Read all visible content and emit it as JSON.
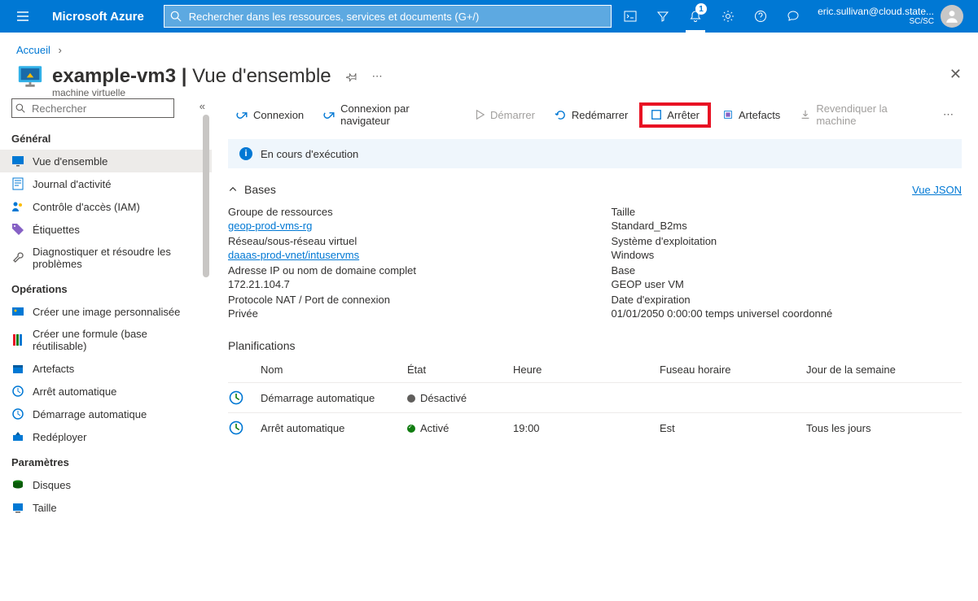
{
  "topbar": {
    "brand": "Microsoft Azure",
    "search_placeholder": "Rechercher dans les ressources, services et documents (G+/)",
    "notification_count": "1",
    "user_email": "eric.sullivan@cloud.state...",
    "user_org": "SC/SC"
  },
  "breadcrumb": {
    "home": "Accueil"
  },
  "header": {
    "title": "example-vm3",
    "view": "Vue d'ensemble",
    "subtitle": "machine virtuelle"
  },
  "sidebar": {
    "search_placeholder": "Rechercher",
    "groups": {
      "general": "Général",
      "operations": "Opérations",
      "parameters": "Paramètres"
    },
    "items": {
      "overview": "Vue d'ensemble",
      "activity": "Journal d'activité",
      "iam": "Contrôle d'accès (IAM)",
      "tags": "Étiquettes",
      "diag": "Diagnostiquer et résoudre les problèmes",
      "create_image": "Créer une image personnalisée",
      "create_formula": "Créer une formule (base réutilisable)",
      "artefacts": "Artefacts",
      "autoshutdown": "Arrêt automatique",
      "autostart": "Démarrage automatique",
      "redeploy": "Redéployer",
      "disks": "Disques",
      "size": "Taille"
    }
  },
  "toolbar": {
    "connect": "Connexion",
    "browser_connect": "Connexion par navigateur",
    "start": "Démarrer",
    "restart": "Redémarrer",
    "stop": "Arrêter",
    "artefacts": "Artefacts",
    "claim": "Revendiquer la machine"
  },
  "status": {
    "running": "En cours d'exécution"
  },
  "bases": {
    "section_title": "Bases",
    "json_link": "Vue JSON",
    "fields": {
      "rg_label": "Groupe de ressources",
      "rg_value": "geop-prod-vms-rg",
      "net_label": "Réseau/sous-réseau virtuel",
      "net_value": "daaas-prod-vnet/intuservms",
      "ip_label": "Adresse IP ou nom de domaine complet",
      "ip_value": "172.21.104.7",
      "nat_label": "Protocole NAT / Port de connexion",
      "nat_value": "Privée",
      "size_label": "Taille",
      "size_value": "Standard_B2ms",
      "os_label": "Système d'exploitation",
      "os_value": "Windows",
      "base_label": "Base",
      "base_value": "GEOP user VM",
      "exp_label": "Date d'expiration",
      "exp_value": "01/01/2050 0:00:00 temps universel coordonné"
    }
  },
  "schedules": {
    "title": "Planifications",
    "headers": {
      "name": "Nom",
      "state": "État",
      "time": "Heure",
      "tz": "Fuseau horaire",
      "dow": "Jour de la semaine"
    },
    "rows": [
      {
        "name": "Démarrage automatique",
        "state": "Désactivé",
        "time": "",
        "tz": "",
        "dow": ""
      },
      {
        "name": "Arrêt automatique",
        "state": "Activé",
        "time": "19:00",
        "tz": "Est",
        "dow": "Tous les jours"
      }
    ]
  }
}
